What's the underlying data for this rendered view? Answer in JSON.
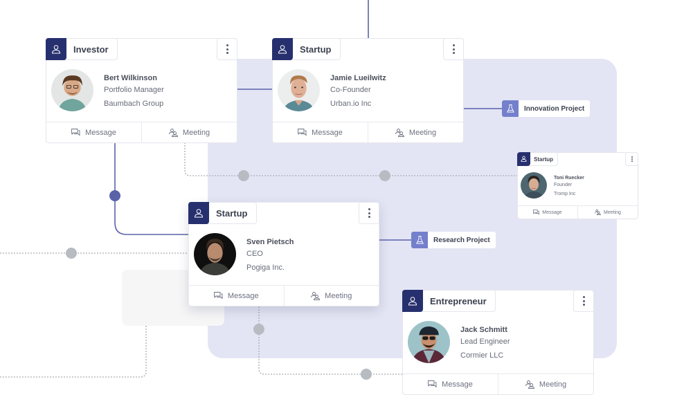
{
  "colors": {
    "tag_icon_bg": "#27306e",
    "project_icon_bg": "#7480cc",
    "connector_solid": "#5a62a8",
    "connector_dotted": "#a7abb2",
    "node_gray": "#b7bcc2",
    "node_blue": "#5a62a8",
    "panel_bg": "#e3e5f4"
  },
  "cards": [
    {
      "id": "investor",
      "tag": "Investor",
      "tag_icon": "user-icon",
      "name": "Bert Wilkinson",
      "role": "Portfolio Manager",
      "company": "Baumbach Group",
      "actions": {
        "message": "Message",
        "meeting": "Meeting"
      }
    },
    {
      "id": "startup-jamie",
      "tag": "Startup",
      "tag_icon": "user-icon",
      "name": "Jamie Lueilwitz",
      "role": "Co-Founder",
      "company": "Urban.io Inc",
      "actions": {
        "message": "Message",
        "meeting": "Meeting"
      }
    },
    {
      "id": "startup-toni",
      "tag": "Startup",
      "tag_icon": "user-icon",
      "name": "Toni Ruecker",
      "role": "Founder",
      "company": "Tromp Inc",
      "actions": {
        "message": "Message",
        "meeting": "Meeting"
      }
    },
    {
      "id": "startup-sven",
      "tag": "Startup",
      "tag_icon": "user-icon",
      "name": "Sven Pietsch",
      "role": "CEO",
      "company": "Pogiga Inc.",
      "actions": {
        "message": "Message",
        "meeting": "Meeting"
      }
    },
    {
      "id": "entrepreneur",
      "tag": "Entrepreneur",
      "tag_icon": "user-icon",
      "name": "Jack Schmitt",
      "role": "Lead Engineer",
      "company": "Cormier LLC",
      "actions": {
        "message": "Message",
        "meeting": "Meeting"
      }
    }
  ],
  "projects": [
    {
      "label": "Innovation Project",
      "icon": "flask-icon"
    },
    {
      "label": "Research Project",
      "icon": "flask-icon"
    }
  ]
}
